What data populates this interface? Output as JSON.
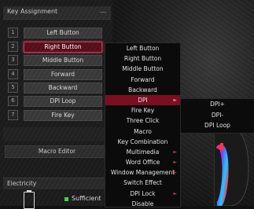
{
  "key_assignment": {
    "title": "Key Assignment",
    "rows": [
      {
        "num": "1",
        "label": "Left Button"
      },
      {
        "num": "2",
        "label": "Right Button",
        "active": true
      },
      {
        "num": "3",
        "label": "Middle Button"
      },
      {
        "num": "4",
        "label": "Forward"
      },
      {
        "num": "5",
        "label": "Backward"
      },
      {
        "num": "6",
        "label": "DPI Loop"
      },
      {
        "num": "7",
        "label": "Fire Key"
      }
    ],
    "macro_editor": "Macro Editor"
  },
  "electricity": {
    "title": "Electricity",
    "status": "Sufficient",
    "status_color": "#3fdc3f"
  },
  "context_menu": {
    "items": [
      {
        "label": "Left Button"
      },
      {
        "label": "Right Button"
      },
      {
        "label": "Middle Button"
      },
      {
        "label": "Forward"
      },
      {
        "label": "Backward"
      },
      {
        "label": "DPI",
        "submenu": true,
        "highlight": true
      },
      {
        "label": "Fire Key"
      },
      {
        "label": "Three Click"
      },
      {
        "label": "Macro"
      },
      {
        "label": "Key Combination"
      },
      {
        "label": "Multimedia",
        "submenu": true
      },
      {
        "label": "Word Office",
        "submenu": true
      },
      {
        "label": "Window Management",
        "submenu": true
      },
      {
        "label": "Switch Effect"
      },
      {
        "label": "DPI Lock",
        "submenu": true
      },
      {
        "label": "Disable"
      }
    ]
  },
  "dpi_submenu": {
    "items": [
      {
        "label": "DPI+"
      },
      {
        "label": "DPI-"
      },
      {
        "label": "DPI Loop"
      }
    ]
  },
  "colors": {
    "accent": "#7a0f22",
    "active_border": "#c43e55",
    "arrow": "#d6314e"
  },
  "icons": {
    "submenu_arrow": "►"
  }
}
